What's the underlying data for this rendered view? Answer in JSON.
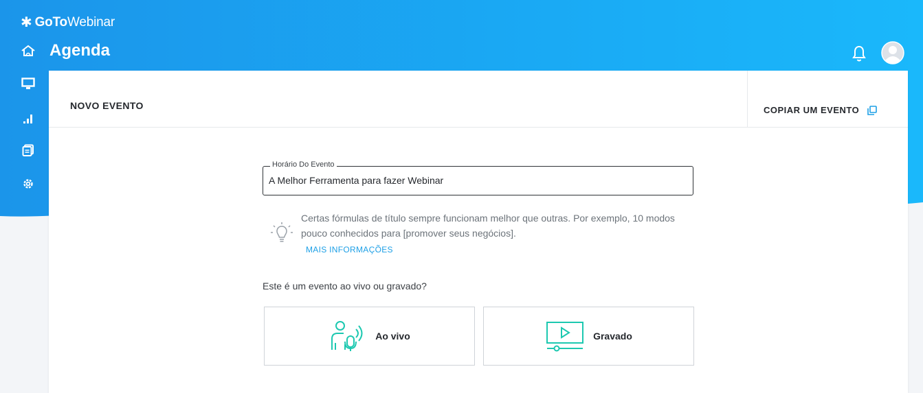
{
  "app": {
    "brand_star": "✱",
    "brand_goto": "GoTo",
    "brand_webinar": "Webinar",
    "page_title": "Agenda"
  },
  "colors": {
    "header_gradient_start": "#1b95ea",
    "header_gradient_end": "#1ab8fb",
    "accent": "#1c9fe6",
    "choice_icon": "#1cc8b0"
  },
  "sidebar": {
    "items": [
      {
        "icon": "home-icon"
      },
      {
        "icon": "monitor-icon"
      },
      {
        "icon": "analytics-icon"
      },
      {
        "icon": "copy-pages-icon"
      },
      {
        "icon": "settings-icon"
      }
    ]
  },
  "topbar": {
    "bell_icon": "bell-icon",
    "avatar_icon": "user-avatar-icon"
  },
  "card": {
    "header_title": "NOVO EVENTO",
    "copy_event_label": "COPIAR UM EVENTO",
    "title_field": {
      "legend": "Horário Do Evento",
      "value": "A Melhor Ferramenta para fazer Webinar"
    },
    "tip": {
      "text": "Certas fórmulas de título sempre funcionam melhor que outras. Por exemplo, 10 modos pouco conhecidos para [promover seus negócios].",
      "link": "MAIS INFORMAÇÕES"
    },
    "question": "Este é um evento ao vivo ou gravado?",
    "choices": [
      {
        "label": "Ao vivo",
        "icon": "live-presenter-icon"
      },
      {
        "label": "Gravado",
        "icon": "recorded-video-icon"
      }
    ]
  }
}
